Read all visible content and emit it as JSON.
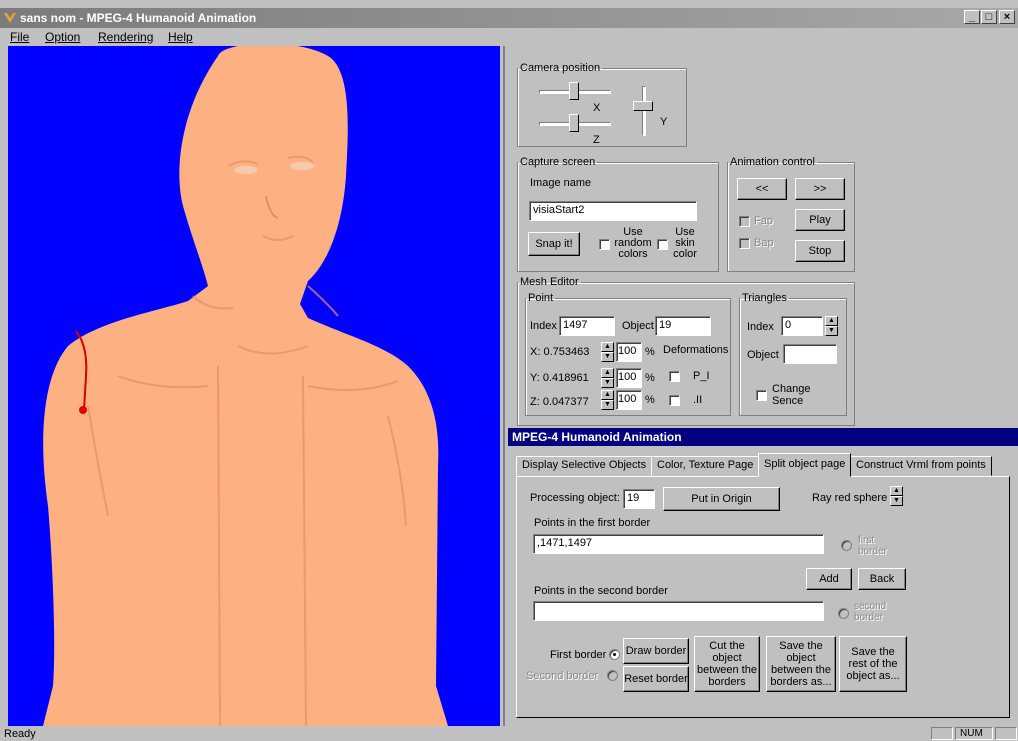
{
  "window": {
    "title": "sans nom - MPEG-4 Humanoid Animation",
    "minimize": "_",
    "restore": "□",
    "close": "×"
  },
  "menu": [
    "File",
    "Option",
    "Rendering",
    "Help"
  ],
  "camera": {
    "legend": "Camera position",
    "x_label": "X",
    "z_label": "Z",
    "y_label": "Y"
  },
  "capture": {
    "legend": "Capture screen",
    "image_name_label": "Image name",
    "image_name_value": "visiaStart2",
    "snap_label": "Snap it!",
    "random_colors_label": "Use random colors",
    "skin_color_label": "Use skin color"
  },
  "animation": {
    "legend": "Animation control",
    "prev_label": "<<",
    "next_label": ">>",
    "fap_label": "Fap",
    "bap_label": "Bap",
    "play_label": "Play",
    "stop_label": "Stop"
  },
  "mesh": {
    "legend": "Mesh Editor",
    "point": {
      "legend": "Point",
      "index_label": "Index",
      "index_value": "1497",
      "object_label": "Object",
      "object_value": "19",
      "x_text": "X: 0.753463",
      "y_text": "Y: 0.418961",
      "z_text": "Z: 0.047377",
      "pct_x": "100",
      "pct_y": "100",
      "pct_z": "100",
      "pct_sign": "%",
      "deformations_label": "Deformations",
      "p_label": "P_I",
      "i_label": ".II"
    },
    "triangles": {
      "legend": "Triangles",
      "index_label": "Index",
      "index_value": "0",
      "object_label": "Object",
      "object_value": "",
      "change_sense_label": "Change Sence"
    }
  },
  "dialog": {
    "title": "MPEG-4 Humanoid Animation",
    "tabs": [
      "Display Selective Objects",
      "Color, Texture Page",
      "Split object page",
      "Construct Vrml from points"
    ],
    "processing_label": "Processing object:",
    "processing_value": "19",
    "put_origin_label": "Put in Origin",
    "ray_label": "Ray red sphere",
    "first_border_points_label": "Points in the first border",
    "first_border_points_value": ",1471,1497",
    "first_border_radio_label": "first border",
    "add_label": "Add",
    "back_label": "Back",
    "second_border_points_label": "Points in the second border",
    "second_border_points_value": "",
    "second_border_radio_label": "second border",
    "first_border_label": "First border",
    "second_border_label": "Second border",
    "draw_border_label": "Draw border",
    "reset_border_label": "Reset border",
    "cut_label": "Cut the object between the borders",
    "save_between_label": "Save the object between the borders as...",
    "save_rest_label": "Save the rest of the object as..."
  },
  "status": {
    "text": "Ready",
    "num": "NUM"
  },
  "colors": {
    "viewport_bg": "#0000fe",
    "skin": "#fdb183",
    "marker": "#e00000",
    "dialog_title_bg": "#000080"
  }
}
